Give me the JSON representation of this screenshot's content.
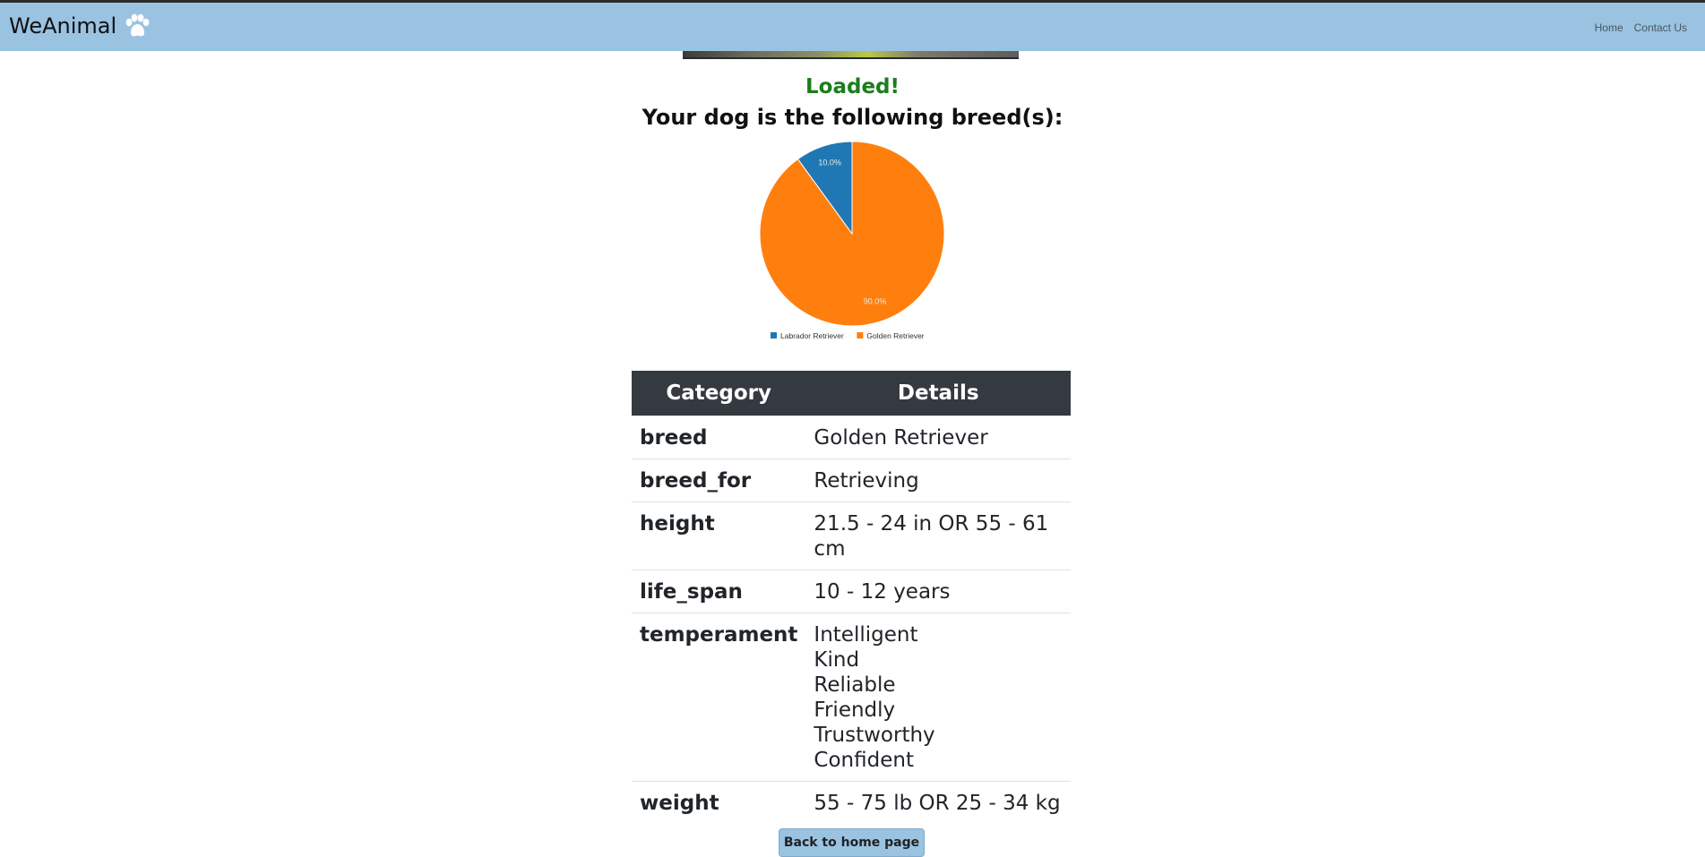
{
  "navbar": {
    "brand": "WeAnimal",
    "links": [
      "Home",
      "Contact Us"
    ]
  },
  "status": "Loaded!",
  "result_heading": "Your dog is the following breed(s):",
  "chart_data": {
    "type": "pie",
    "title": "",
    "slices": [
      {
        "label": "Labrador Retriever",
        "value": 10.0,
        "color": "#1f77b4"
      },
      {
        "label": "Golden Retriever",
        "value": 90.0,
        "color": "#ff7f0e"
      }
    ],
    "data_labels": [
      "10.0%",
      "90.0%"
    ],
    "legend": "bottom"
  },
  "table": {
    "headers": [
      "Category",
      "Details"
    ],
    "rows": [
      {
        "category": "breed",
        "details": [
          "Golden Retriever"
        ]
      },
      {
        "category": "breed_for",
        "details": [
          "Retrieving"
        ]
      },
      {
        "category": "height",
        "details": [
          "21.5 - 24 in OR 55 - 61 cm"
        ]
      },
      {
        "category": "life_span",
        "details": [
          "10 - 12 years"
        ]
      },
      {
        "category": "temperament",
        "details": [
          "Intelligent",
          "Kind",
          "Reliable",
          "Friendly",
          "Trustworthy",
          "Confident"
        ]
      },
      {
        "category": "weight",
        "details": [
          "55 - 75 lb OR 25 - 34 kg"
        ]
      }
    ]
  },
  "back_button": "Back to home page"
}
